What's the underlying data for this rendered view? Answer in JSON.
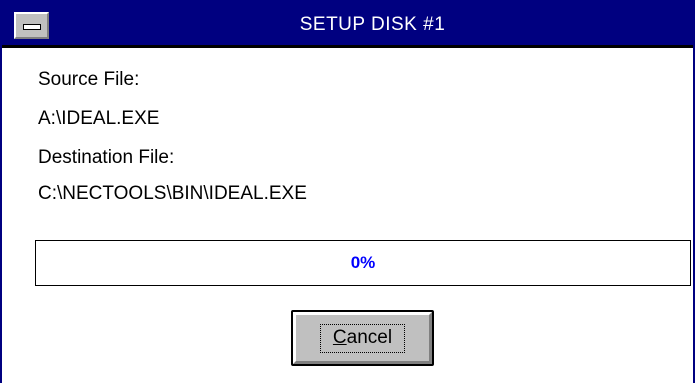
{
  "window": {
    "title": "SETUP DISK #1",
    "system_menu_icon": "minus-bar-icon"
  },
  "labels": {
    "source_heading": "Source File:",
    "source_path": "A:\\IDEAL.EXE",
    "destination_heading": "Destination File:",
    "destination_path": "C:\\NECTOOLS\\BIN\\IDEAL.EXE"
  },
  "progress": {
    "value": 0,
    "text": "0%"
  },
  "buttons": {
    "cancel_first": "C",
    "cancel_rest": "ancel"
  },
  "colors": {
    "titlebar": "#000080",
    "progress_text": "#0000ff",
    "button_face": "#c0c0c0"
  }
}
